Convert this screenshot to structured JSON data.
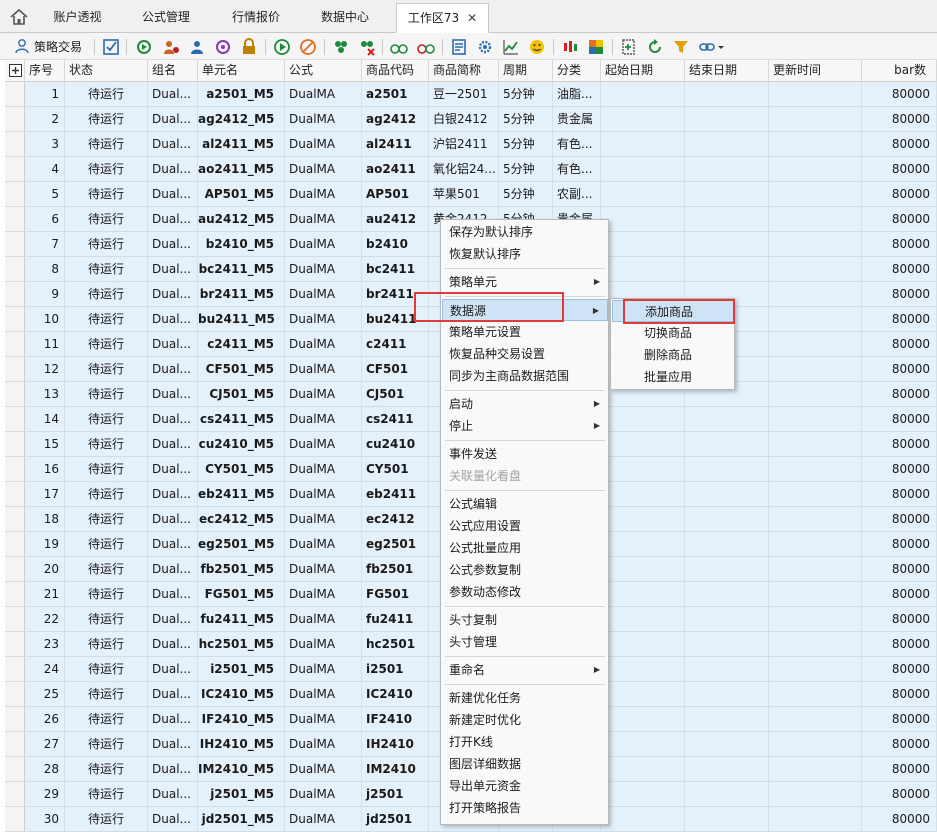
{
  "tabs": [
    "账户透视",
    "公式管理",
    "行情报价",
    "数据中心",
    "工作区73"
  ],
  "active_tab_close": "✕",
  "toolbar": {
    "strategy_trade_label": "策略交易"
  },
  "columns": [
    "序号",
    "状态",
    "组名",
    "单元名",
    "公式",
    "商品代码",
    "商品简称",
    "周期",
    "分类",
    "起始日期",
    "结束日期",
    "更新时间",
    "bar数"
  ],
  "rows": [
    {
      "no": "1",
      "status": "待运行",
      "group": "Dual...",
      "unit": "a2501_M5",
      "formula": "DualMA",
      "code": "a2501",
      "name": "豆一2501",
      "period": "5分钟",
      "cat": "油脂...",
      "bars": "80000"
    },
    {
      "no": "2",
      "status": "待运行",
      "group": "Dual...",
      "unit": "ag2412_M5",
      "formula": "DualMA",
      "code": "ag2412",
      "name": "白银2412",
      "period": "5分钟",
      "cat": "贵金属",
      "bars": "80000"
    },
    {
      "no": "3",
      "status": "待运行",
      "group": "Dual...",
      "unit": "al2411_M5",
      "formula": "DualMA",
      "code": "al2411",
      "name": "沪铝2411",
      "period": "5分钟",
      "cat": "有色...",
      "bars": "80000"
    },
    {
      "no": "4",
      "status": "待运行",
      "group": "Dual...",
      "unit": "ao2411_M5",
      "formula": "DualMA",
      "code": "ao2411",
      "name": "氧化铝24...",
      "period": "5分钟",
      "cat": "有色...",
      "bars": "80000"
    },
    {
      "no": "5",
      "status": "待运行",
      "group": "Dual...",
      "unit": "AP501_M5",
      "formula": "DualMA",
      "code": "AP501",
      "name": "苹果501",
      "period": "5分钟",
      "cat": "农副...",
      "bars": "80000"
    },
    {
      "no": "6",
      "status": "待运行",
      "group": "Dual...",
      "unit": "au2412_M5",
      "formula": "DualMA",
      "code": "au2412",
      "name": "黄金2412",
      "period": "5分钟",
      "cat": "贵金属",
      "bars": "80000"
    },
    {
      "no": "7",
      "status": "待运行",
      "group": "Dual...",
      "unit": "b2410_M5",
      "formula": "DualMA",
      "code": "b2410",
      "name": "",
      "period": "",
      "cat": "",
      "bars": "80000"
    },
    {
      "no": "8",
      "status": "待运行",
      "group": "Dual...",
      "unit": "bc2411_M5",
      "formula": "DualMA",
      "code": "bc2411",
      "name": "",
      "period": "",
      "cat": "",
      "bars": "80000"
    },
    {
      "no": "9",
      "status": "待运行",
      "group": "Dual...",
      "unit": "br2411_M5",
      "formula": "DualMA",
      "code": "br2411",
      "name": "",
      "period": "",
      "cat": "",
      "bars": "80000"
    },
    {
      "no": "10",
      "status": "待运行",
      "group": "Dual...",
      "unit": "bu2411_M5",
      "formula": "DualMA",
      "code": "bu2411",
      "name": "",
      "period": "",
      "cat": "",
      "bars": "80000"
    },
    {
      "no": "11",
      "status": "待运行",
      "group": "Dual...",
      "unit": "c2411_M5",
      "formula": "DualMA",
      "code": "c2411",
      "name": "",
      "period": "",
      "cat": "",
      "bars": "80000"
    },
    {
      "no": "12",
      "status": "待运行",
      "group": "Dual...",
      "unit": "CF501_M5",
      "formula": "DualMA",
      "code": "CF501",
      "name": "",
      "period": "",
      "cat": "",
      "bars": "80000"
    },
    {
      "no": "13",
      "status": "待运行",
      "group": "Dual...",
      "unit": "CJ501_M5",
      "formula": "DualMA",
      "code": "CJ501",
      "name": "",
      "period": "",
      "cat": "",
      "bars": "80000"
    },
    {
      "no": "14",
      "status": "待运行",
      "group": "Dual...",
      "unit": "cs2411_M5",
      "formula": "DualMA",
      "code": "cs2411",
      "name": "",
      "period": "",
      "cat": "",
      "bars": "80000"
    },
    {
      "no": "15",
      "status": "待运行",
      "group": "Dual...",
      "unit": "cu2410_M5",
      "formula": "DualMA",
      "code": "cu2410",
      "name": "",
      "period": "",
      "cat": "",
      "bars": "80000"
    },
    {
      "no": "16",
      "status": "待运行",
      "group": "Dual...",
      "unit": "CY501_M5",
      "formula": "DualMA",
      "code": "CY501",
      "name": "",
      "period": "",
      "cat": "",
      "bars": "80000"
    },
    {
      "no": "17",
      "status": "待运行",
      "group": "Dual...",
      "unit": "eb2411_M5",
      "formula": "DualMA",
      "code": "eb2411",
      "name": "",
      "period": "",
      "cat": "",
      "bars": "80000"
    },
    {
      "no": "18",
      "status": "待运行",
      "group": "Dual...",
      "unit": "ec2412_M5",
      "formula": "DualMA",
      "code": "ec2412",
      "name": "",
      "period": "",
      "cat": "",
      "bars": "80000"
    },
    {
      "no": "19",
      "status": "待运行",
      "group": "Dual...",
      "unit": "eg2501_M5",
      "formula": "DualMA",
      "code": "eg2501",
      "name": "",
      "period": "",
      "cat": "",
      "bars": "80000"
    },
    {
      "no": "20",
      "status": "待运行",
      "group": "Dual...",
      "unit": "fb2501_M5",
      "formula": "DualMA",
      "code": "fb2501",
      "name": "",
      "period": "",
      "cat": "",
      "bars": "80000"
    },
    {
      "no": "21",
      "status": "待运行",
      "group": "Dual...",
      "unit": "FG501_M5",
      "formula": "DualMA",
      "code": "FG501",
      "name": "",
      "period": "",
      "cat": "",
      "bars": "80000"
    },
    {
      "no": "22",
      "status": "待运行",
      "group": "Dual...",
      "unit": "fu2411_M5",
      "formula": "DualMA",
      "code": "fu2411",
      "name": "",
      "period": "",
      "cat": "",
      "bars": "80000"
    },
    {
      "no": "23",
      "status": "待运行",
      "group": "Dual...",
      "unit": "hc2501_M5",
      "formula": "DualMA",
      "code": "hc2501",
      "name": "",
      "period": "",
      "cat": "",
      "bars": "80000"
    },
    {
      "no": "24",
      "status": "待运行",
      "group": "Dual...",
      "unit": "i2501_M5",
      "formula": "DualMA",
      "code": "i2501",
      "name": "",
      "period": "",
      "cat": "",
      "bars": "80000"
    },
    {
      "no": "25",
      "status": "待运行",
      "group": "Dual...",
      "unit": "IC2410_M5",
      "formula": "DualMA",
      "code": "IC2410",
      "name": "",
      "period": "",
      "cat": "",
      "bars": "80000"
    },
    {
      "no": "26",
      "status": "待运行",
      "group": "Dual...",
      "unit": "IF2410_M5",
      "formula": "DualMA",
      "code": "IF2410",
      "name": "",
      "period": "",
      "cat": "",
      "bars": "80000"
    },
    {
      "no": "27",
      "status": "待运行",
      "group": "Dual...",
      "unit": "IH2410_M5",
      "formula": "DualMA",
      "code": "IH2410",
      "name": "",
      "period": "",
      "cat": "",
      "bars": "80000"
    },
    {
      "no": "28",
      "status": "待运行",
      "group": "Dual...",
      "unit": "IM2410_M5",
      "formula": "DualMA",
      "code": "IM2410",
      "name": "",
      "period": "",
      "cat": "",
      "bars": "80000"
    },
    {
      "no": "29",
      "status": "待运行",
      "group": "Dual...",
      "unit": "j2501_M5",
      "formula": "DualMA",
      "code": "j2501",
      "name": "",
      "period": "",
      "cat": "",
      "bars": "80000"
    },
    {
      "no": "30",
      "status": "待运行",
      "group": "Dual...",
      "unit": "jd2501_M5",
      "formula": "DualMA",
      "code": "jd2501",
      "name": "",
      "period": "",
      "cat": "",
      "bars": "80000"
    }
  ],
  "context_menu": {
    "items": [
      {
        "label": "保存为默认排序"
      },
      {
        "label": "恢复默认排序"
      },
      {
        "label": "策略单元"
      },
      {
        "label": "数据源"
      },
      {
        "label": "策略单元设置"
      },
      {
        "label": "恢复品种交易设置"
      },
      {
        "label": "同步为主商品数据范围"
      },
      {
        "label": "启动"
      },
      {
        "label": "停止"
      },
      {
        "label": "事件发送"
      },
      {
        "label": "关联量化看盘"
      },
      {
        "label": "公式编辑"
      },
      {
        "label": "公式应用设置"
      },
      {
        "label": "公式批量应用"
      },
      {
        "label": "公式参数复制"
      },
      {
        "label": "参数动态修改"
      },
      {
        "label": "头寸复制"
      },
      {
        "label": "头寸管理"
      },
      {
        "label": "重命名"
      },
      {
        "label": "新建优化任务"
      },
      {
        "label": "新建定时优化"
      },
      {
        "label": "打开K线"
      },
      {
        "label": "图层详细数据"
      },
      {
        "label": "导出单元资金"
      },
      {
        "label": "打开策略报告"
      }
    ]
  },
  "submenu": {
    "items": [
      "添加商品",
      "切换商品",
      "删除商品",
      "批量应用"
    ]
  },
  "colors": {
    "row_bg": "#e4f0fa",
    "highlight": "#cfe3f6",
    "annotation_red": "#e13a3a"
  }
}
